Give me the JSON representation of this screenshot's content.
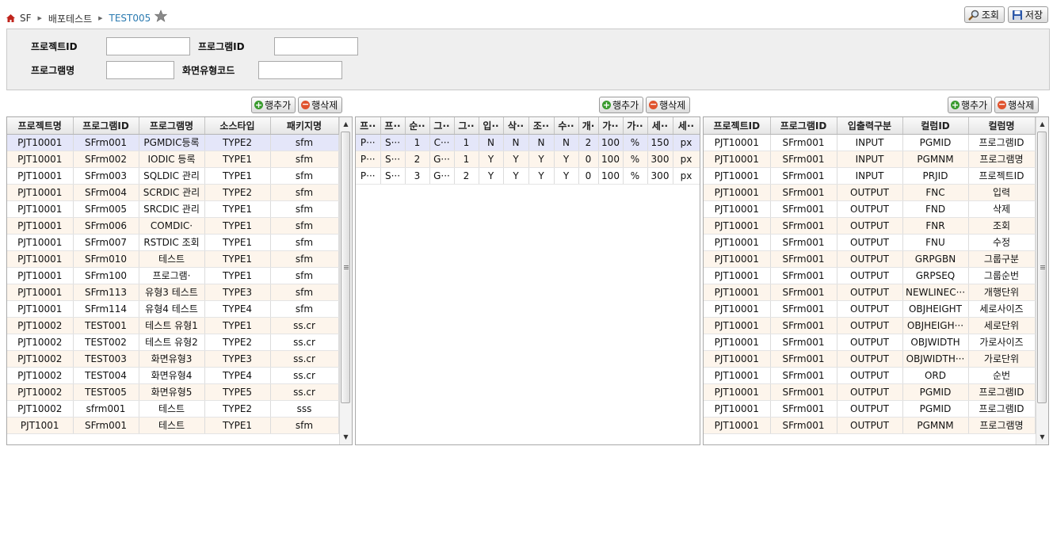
{
  "breadcrumb": {
    "items": [
      "SF",
      "배포테스트"
    ],
    "current": "TEST005"
  },
  "toolbar": {
    "search_label": "조회",
    "save_label": "저장"
  },
  "search_form": {
    "project_id_label": "프로젝트ID",
    "project_id_value": "",
    "program_id_label": "프로그램ID",
    "program_id_value": "",
    "program_name_label": "프로그램명",
    "program_name_value": "",
    "screen_type_label": "화면유형코드",
    "screen_type_value": ""
  },
  "grid_buttons": {
    "add_label": "행추가",
    "delete_label": "행삭제"
  },
  "grid1": {
    "columns": [
      "프로젝트명",
      "프로그램ID",
      "프로그램명",
      "소스타입",
      "패키지명"
    ],
    "rows": [
      [
        "PJT10001",
        "SFrm001",
        "PGMDIC등록",
        "TYPE2",
        "sfm"
      ],
      [
        "PJT10001",
        "SFrm002",
        "IODIC 등록",
        "TYPE1",
        "sfm"
      ],
      [
        "PJT10001",
        "SFrm003",
        "SQLDIC 관리",
        "TYPE1",
        "sfm"
      ],
      [
        "PJT10001",
        "SFrm004",
        "SCRDIC 관리",
        "TYPE2",
        "sfm"
      ],
      [
        "PJT10001",
        "SFrm005",
        "SRCDIC 관리",
        "TYPE1",
        "sfm"
      ],
      [
        "PJT10001",
        "SFrm006",
        "COMDIC·",
        "TYPE1",
        "sfm"
      ],
      [
        "PJT10001",
        "SFrm007",
        "RSTDIC 조회",
        "TYPE1",
        "sfm"
      ],
      [
        "PJT10001",
        "SFrm010",
        "테스트",
        "TYPE1",
        "sfm"
      ],
      [
        "PJT10001",
        "SFrm100",
        "프로그램·",
        "TYPE1",
        "sfm"
      ],
      [
        "PJT10001",
        "SFrm113",
        "유형3 테스트",
        "TYPE3",
        "sfm"
      ],
      [
        "PJT10001",
        "SFrm114",
        "유형4 테스트",
        "TYPE4",
        "sfm"
      ],
      [
        "PJT10002",
        "TEST001",
        "테스트 유형1",
        "TYPE1",
        "ss.cr"
      ],
      [
        "PJT10002",
        "TEST002",
        "테스트 유형2",
        "TYPE2",
        "ss.cr"
      ],
      [
        "PJT10002",
        "TEST003",
        "화면유형3",
        "TYPE3",
        "ss.cr"
      ],
      [
        "PJT10002",
        "TEST004",
        "화면유형4",
        "TYPE4",
        "ss.cr"
      ],
      [
        "PJT10002",
        "TEST005",
        "화면유형5",
        "TYPE5",
        "ss.cr"
      ],
      [
        "PJT10002",
        "sfrm001",
        "테스트",
        "TYPE2",
        "sss"
      ],
      [
        "PJT1001",
        "SFrm001",
        "테스트",
        "TYPE1",
        "sfm"
      ]
    ]
  },
  "grid2": {
    "columns": [
      "프··",
      "프··",
      "순··",
      "그··",
      "그··",
      "입··",
      "삭··",
      "조··",
      "수··",
      "개·",
      "가··",
      "가··",
      "세··",
      "세··"
    ],
    "rows": [
      [
        "P···",
        "S···",
        "1",
        "C···",
        "1",
        "N",
        "N",
        "N",
        "N",
        "2",
        "100",
        "%",
        "150",
        "px"
      ],
      [
        "P···",
        "S···",
        "2",
        "G···",
        "1",
        "Y",
        "Y",
        "Y",
        "Y",
        "0",
        "100",
        "%",
        "300",
        "px"
      ],
      [
        "P···",
        "S···",
        "3",
        "G···",
        "2",
        "Y",
        "Y",
        "Y",
        "Y",
        "0",
        "100",
        "%",
        "300",
        "px"
      ]
    ]
  },
  "grid3": {
    "columns": [
      "프로젝트ID",
      "프로그램ID",
      "입출력구분",
      "컬럼ID",
      "컬럼명"
    ],
    "rows": [
      [
        "PJT10001",
        "SFrm001",
        "INPUT",
        "PGMID",
        "프로그램ID"
      ],
      [
        "PJT10001",
        "SFrm001",
        "INPUT",
        "PGMNM",
        "프로그램명"
      ],
      [
        "PJT10001",
        "SFrm001",
        "INPUT",
        "PRJID",
        "프로젝트ID"
      ],
      [
        "PJT10001",
        "SFrm001",
        "OUTPUT",
        "FNC",
        "입력"
      ],
      [
        "PJT10001",
        "SFrm001",
        "OUTPUT",
        "FND",
        "삭제"
      ],
      [
        "PJT10001",
        "SFrm001",
        "OUTPUT",
        "FNR",
        "조회"
      ],
      [
        "PJT10001",
        "SFrm001",
        "OUTPUT",
        "FNU",
        "수정"
      ],
      [
        "PJT10001",
        "SFrm001",
        "OUTPUT",
        "GRPGBN",
        "그룹구분"
      ],
      [
        "PJT10001",
        "SFrm001",
        "OUTPUT",
        "GRPSEQ",
        "그룹순번"
      ],
      [
        "PJT10001",
        "SFrm001",
        "OUTPUT",
        "NEWLINEC···",
        "개행단위"
      ],
      [
        "PJT10001",
        "SFrm001",
        "OUTPUT",
        "OBJHEIGHT",
        "세로사이즈"
      ],
      [
        "PJT10001",
        "SFrm001",
        "OUTPUT",
        "OBJHEIGH···",
        "세로단위"
      ],
      [
        "PJT10001",
        "SFrm001",
        "OUTPUT",
        "OBJWIDTH",
        "가로사이즈"
      ],
      [
        "PJT10001",
        "SFrm001",
        "OUTPUT",
        "OBJWIDTH···",
        "가로단위"
      ],
      [
        "PJT10001",
        "SFrm001",
        "OUTPUT",
        "ORD",
        "순번"
      ],
      [
        "PJT10001",
        "SFrm001",
        "OUTPUT",
        "PGMID",
        "프로그램ID"
      ],
      [
        "PJT10001",
        "SFrm001",
        "OUTPUT",
        "PGMID",
        "프로그램ID"
      ],
      [
        "PJT10001",
        "SFrm001",
        "OUTPUT",
        "PGMNM",
        "프로그램명"
      ]
    ]
  },
  "colors": {
    "accent": "#2a7ab0",
    "row_alt": "#fdf5ec",
    "row_selected": "#e4e6f9",
    "panel_bg": "#efefef"
  },
  "icons": [
    "home-icon",
    "star-icon",
    "search-icon",
    "save-icon",
    "plus-icon",
    "minus-icon"
  ]
}
